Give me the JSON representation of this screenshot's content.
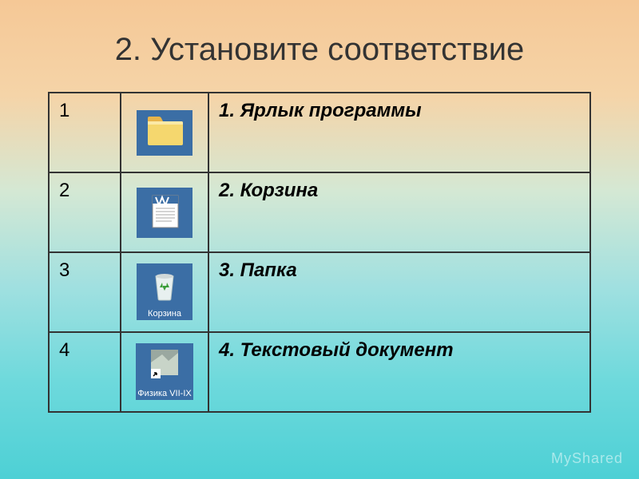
{
  "title": "2. Установите соответствие",
  "rows": [
    {
      "num": "1",
      "icon_name": "folder-icon",
      "caption": "",
      "desc": "1. Ярлык программы"
    },
    {
      "num": "2",
      "icon_name": "word-icon",
      "caption": "",
      "desc": "2. Корзина"
    },
    {
      "num": "3",
      "icon_name": "recycle-icon",
      "caption": "Корзина",
      "desc": "3. Папка"
    },
    {
      "num": "4",
      "icon_name": "shortcut-icon",
      "caption": "Физика VII-IX",
      "desc": "4. Текстовый документ"
    }
  ],
  "watermark": "MyShared"
}
